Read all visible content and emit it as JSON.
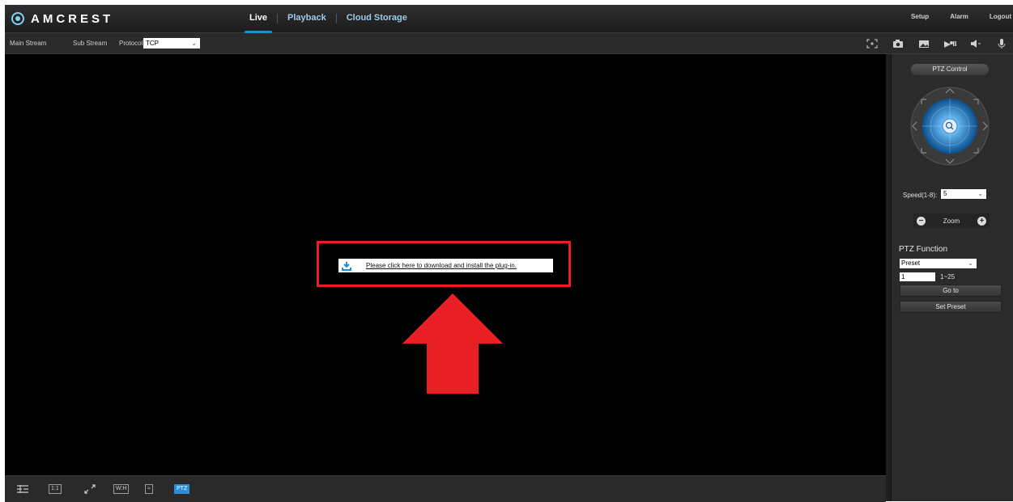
{
  "brand": {
    "logo_text": "AMCREST"
  },
  "nav": {
    "live": "Live",
    "playback": "Playback",
    "cloud": "Cloud Storage"
  },
  "top_right": {
    "setup": "Setup",
    "alarm": "Alarm",
    "logout": "Logout"
  },
  "toolbar": {
    "main_stream": "Main Stream",
    "sub_stream": "Sub Stream",
    "protocol_label": "Protocol",
    "protocol_value": "TCP"
  },
  "plugin": {
    "link_text": "Please click here to download and install the plug-in."
  },
  "bottombar": {
    "ratio": "1:1",
    "wh": "W:H",
    "ptz": "PTZ"
  },
  "ptz": {
    "title": "PTZ Control",
    "speed_label": "Speed(1-8):",
    "speed_value": "5",
    "zoom_label": "Zoom",
    "function_title": "PTZ Function",
    "function_value": "Preset",
    "preset_number": "1",
    "preset_range": "1~25",
    "goto_label": "Go to",
    "set_preset_label": "Set Preset"
  },
  "colors": {
    "accent": "#1e8ed8",
    "highlight_red": "#e81f25",
    "nav_link": "#9ecbe9"
  }
}
